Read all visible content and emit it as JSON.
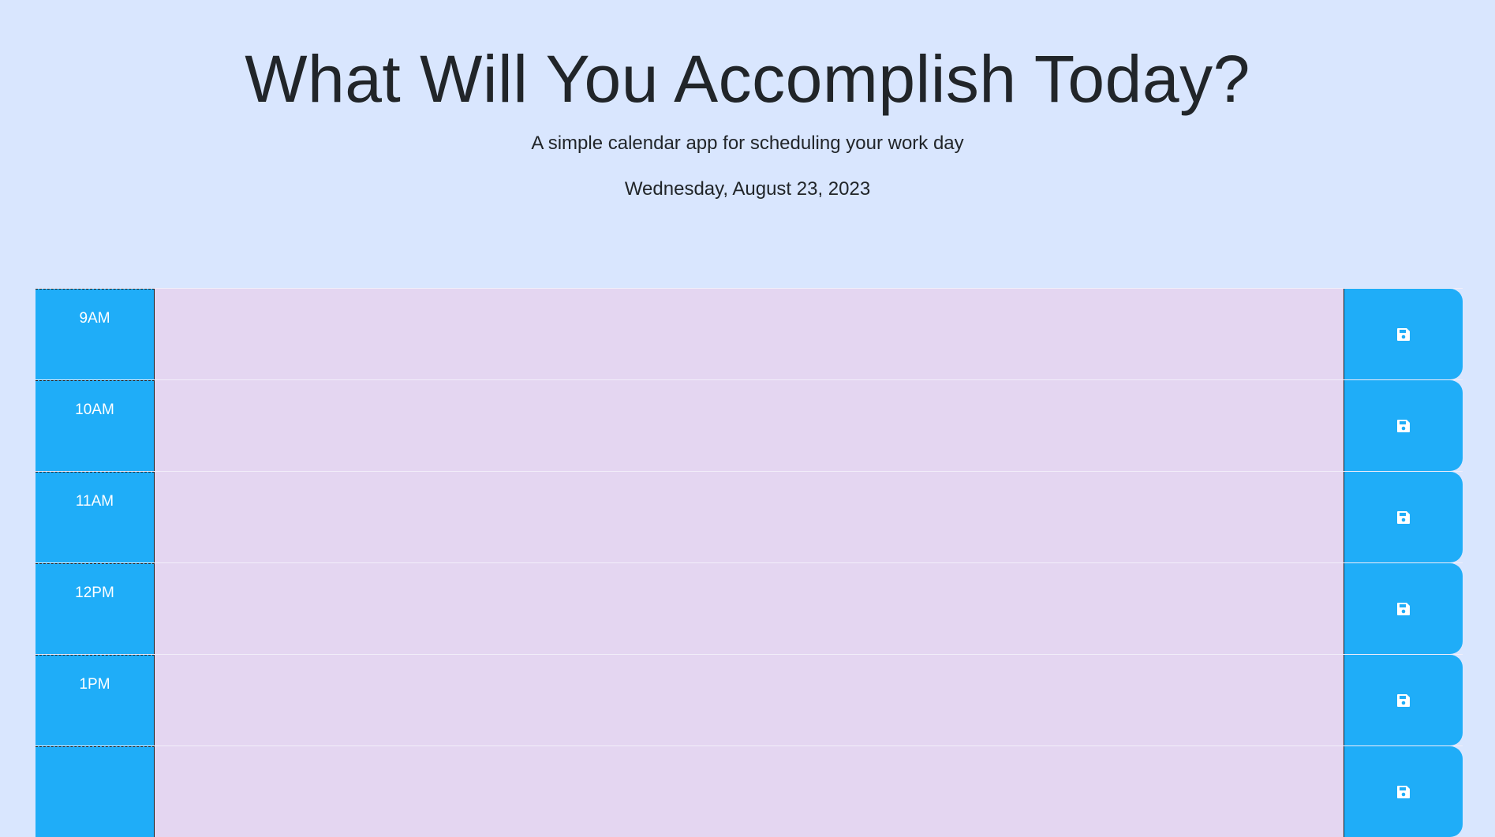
{
  "header": {
    "title": "What Will You Accomplish Today?",
    "subtitle": "A simple calendar app for scheduling your work day",
    "date": "Wednesday, August 23, 2023"
  },
  "colors": {
    "page_background": "#d9e6fe",
    "hour_block": "#1fadf8",
    "description_future": "#e4d6f1",
    "save_button": "#1fadf8"
  },
  "rows": [
    {
      "hour": "9AM",
      "text": "",
      "icon": "floppy-disk-icon"
    },
    {
      "hour": "10AM",
      "text": "",
      "icon": "floppy-disk-icon"
    },
    {
      "hour": "11AM",
      "text": "",
      "icon": "floppy-disk-icon"
    },
    {
      "hour": "12PM",
      "text": "",
      "icon": "floppy-disk-icon"
    },
    {
      "hour": "1PM",
      "text": "",
      "icon": "floppy-disk-icon"
    },
    {
      "hour": "",
      "text": "",
      "icon": "floppy-disk-icon"
    }
  ]
}
